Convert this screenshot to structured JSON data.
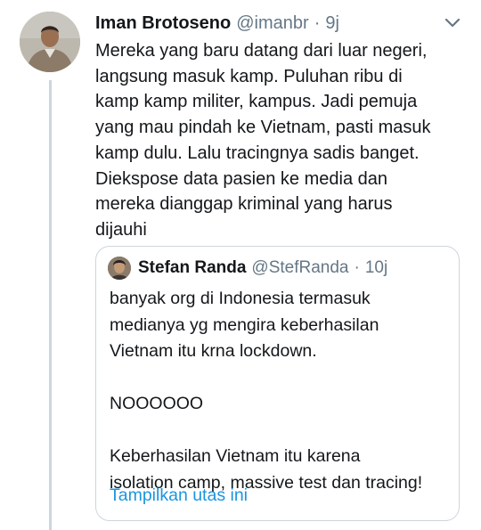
{
  "tweet": {
    "author_name": "Iman Brotoseno",
    "author_handle": "@imanbr",
    "separator": "·",
    "timestamp": "9j",
    "lines": [
      "Mereka yang baru datang dari luar negeri,",
      "langsung masuk kamp. Puluhan ribu di",
      "kamp kamp militer, kampus. Jadi pemuja",
      "yang mau pindah ke Vietnam, pasti masuk",
      "kamp dulu. Lalu tracingnya sadis banget.",
      "Diekspose data pasien ke media dan",
      "mereka dianggap kriminal yang harus",
      "dijauhi"
    ],
    "menu_icon": "chevron-down-icon"
  },
  "quoted_tweet": {
    "author_name": "Stefan Randa",
    "author_handle": "@StefRanda",
    "separator": "·",
    "timestamp": "10j",
    "paragraph1": [
      "banyak org di Indonesia termasuk",
      "medianya yg mengira keberhasilan",
      "Vietnam itu krna lockdown."
    ],
    "paragraph2": "NOOOOOO",
    "paragraph3": [
      "Keberhasilan Vietnam itu karena",
      "isolation camp, massive test dan tracing!"
    ],
    "show_thread": "Tampilkan utas ini"
  },
  "colors": {
    "text": "#14171a",
    "secondary": "#657786",
    "link": "#1b95e0",
    "border": "#ccd6dd"
  }
}
